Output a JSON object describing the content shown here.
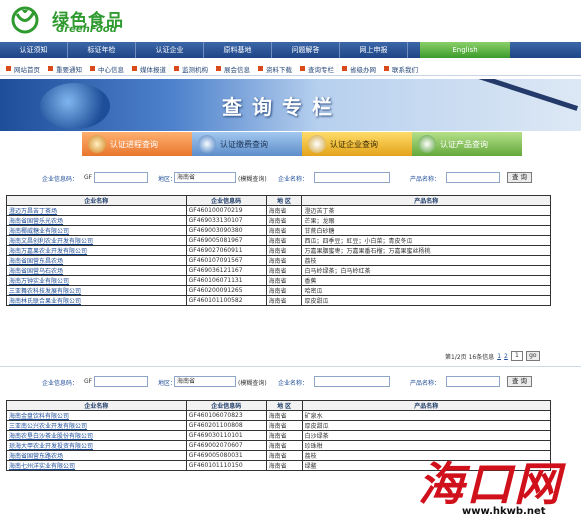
{
  "header": {
    "logo_cn": "绿色食品",
    "logo_en": "GreenFood"
  },
  "topnav": {
    "items": [
      "认证须知",
      "标证年检",
      "认证企业",
      "原料基地",
      "问题解答",
      "网上申报"
    ],
    "english": "English"
  },
  "subnav": {
    "items": [
      "网站首页",
      "重要通知",
      "中心信息",
      "媒体报道",
      "监测机构",
      "展会信息",
      "资料下载",
      "查询专栏",
      "省级办网",
      "联系我们"
    ]
  },
  "banner": {
    "title": "查询专栏"
  },
  "query_tabs": [
    "认证进程查询",
    "认证缴费查询",
    "认证企业查询",
    "认证产品查询"
  ],
  "search1": {
    "enterprise_code_label": "企业信息码：",
    "enterprise_code_value": "GF",
    "region_label": "地区：",
    "region_value": "海南省",
    "fuzzy_hint": "(模糊查询)",
    "company_label": "企业名称：",
    "product_label": "产品名称：",
    "button": "查 询"
  },
  "search2": {
    "enterprise_code_label": "企业信息码：",
    "enterprise_code_value": "GF",
    "region_label": "地区：",
    "region_value": "海南省",
    "fuzzy_hint": "(模糊查询)",
    "company_label": "企业名称：",
    "product_label": "产品名称：",
    "button": "查 询"
  },
  "table_headers": [
    "企业名称",
    "企业信息码",
    "地 区",
    "产品名称"
  ],
  "table1": [
    [
      "澄迈万昌苦丁茶场",
      "GF460100070219",
      "海南省",
      "澄迈苦丁茶"
    ],
    [
      "海南省国营乐光农场",
      "GF469033130107",
      "海南省",
      "芒果；龙眼"
    ],
    [
      "海南椰威糖业有限公司",
      "GF469003090380",
      "海南省",
      "甘蔗白砂糖"
    ],
    [
      "海南文昌创利农业开发有限公司",
      "GF469005081967",
      "海南省",
      "西瓜；四季豆；豇豆；小白菜；青皮冬瓜"
    ],
    [
      "海南万嘉果农业开发有限公司",
      "GF469027060911",
      "海南省",
      "万嘉果胭蜜枣；万嘉果番石榴；万嘉果蜜丝杨桃"
    ],
    [
      "海南省国营东昌农场",
      "GF460107091567",
      "海南省",
      "荔枝"
    ],
    [
      "海南省国营乌石农场",
      "GF469036121167",
      "海南省",
      "白马岭绿茶；白马岭红茶"
    ],
    [
      "海南万钟实业有限公司",
      "GF460106071131",
      "海南省",
      "香蕉"
    ],
    [
      "三亚舞农科技发展有限公司",
      "GF460200091265",
      "海南省",
      "哈密瓜"
    ],
    [
      "海南林氏联合果业有限公司",
      "GF460101100582",
      "海南省",
      "厚皮甜瓜"
    ]
  ],
  "pager": {
    "info": "第1/2页 16条信息",
    "links": [
      "1",
      "2"
    ],
    "current_input": "1",
    "go": "go"
  },
  "table2": [
    [
      "海南金盘饮料有限公司",
      "GF460106070823",
      "海南省",
      "矿泉水"
    ],
    [
      "三亚南公兴农业开发有限公司",
      "GF460201100808",
      "海南省",
      "厚皮甜瓜"
    ],
    [
      "海南农垦白沙茶业股份有限公司",
      "GF469030110101",
      "海南省",
      "白沙绿茶"
    ],
    [
      "琼海大甲农业开发投资有限公司",
      "GF469002070607",
      "海南省",
      "珍珠柑"
    ],
    [
      "海南省国营东路农场",
      "GF469005080031",
      "海南省",
      "荔枝"
    ],
    [
      "海南七州洋实业有限公司",
      "GF460101110150",
      "海南省",
      "绿鳌"
    ]
  ],
  "watermark": {
    "cn": "海口网",
    "url": "www.hkwb.net"
  },
  "colors": {
    "brand_green": "#2f9a2f",
    "nav_blue": "#1f4587",
    "link_blue": "#1f4e99",
    "watermark_red": "#d0101a"
  }
}
